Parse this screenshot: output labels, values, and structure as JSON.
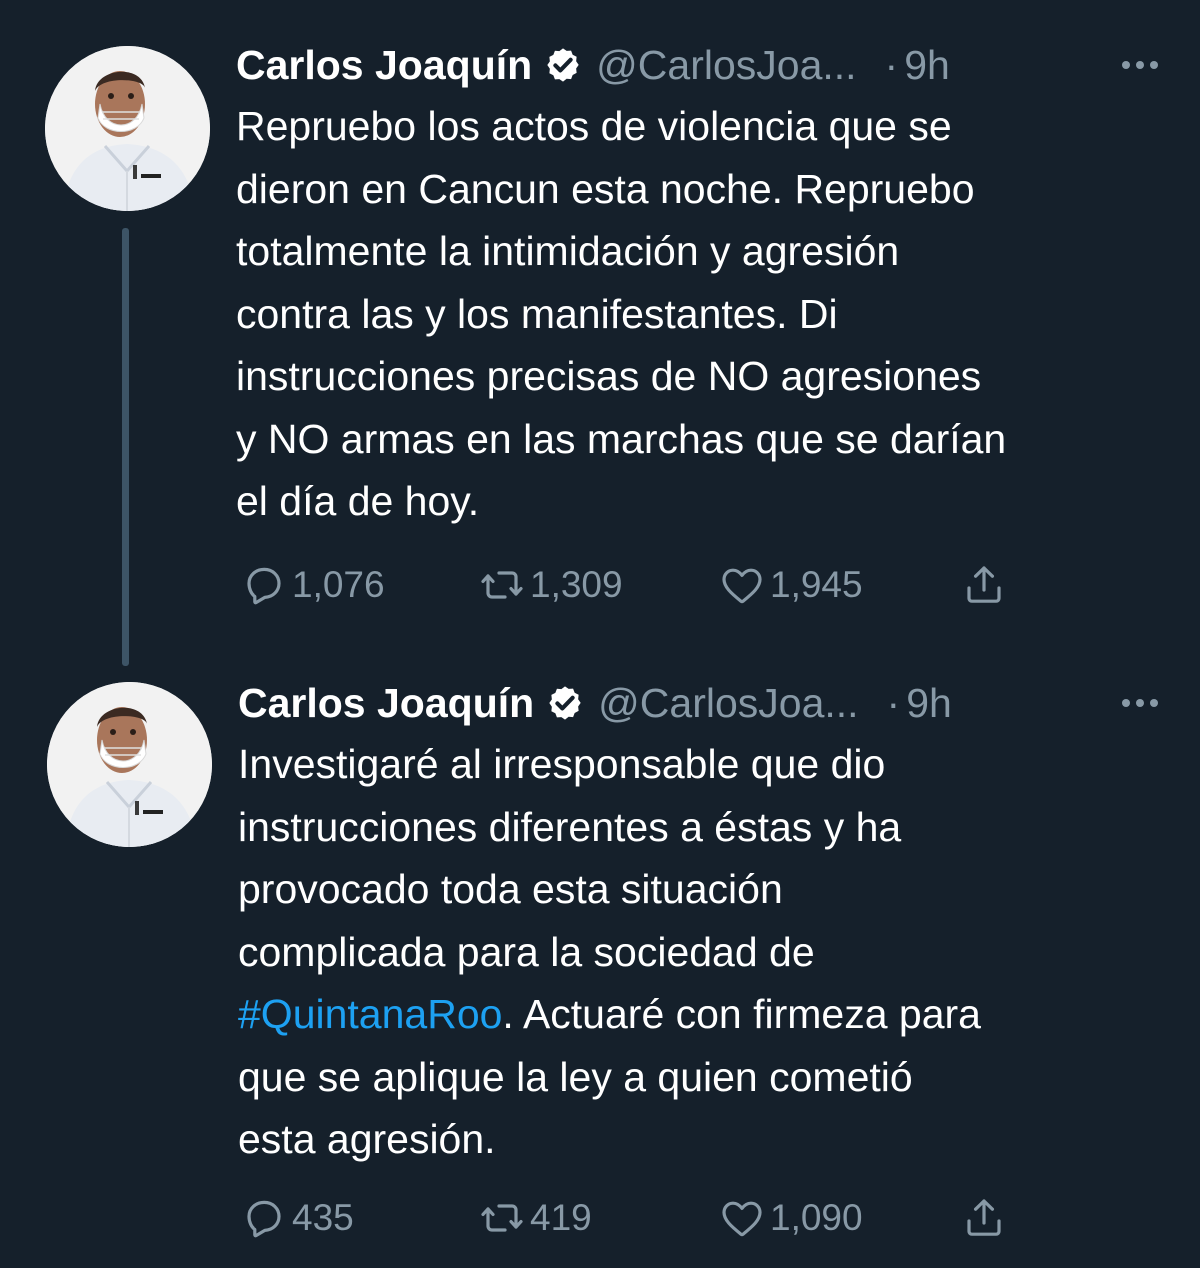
{
  "colors": {
    "background": "#15202b",
    "text": "#ffffff",
    "muted": "#8899a6",
    "link": "#1da1f2",
    "thread_line": "#3d5466"
  },
  "tweets": [
    {
      "author": {
        "name": "Carlos Joaquín",
        "handle": "@CarlosJoa...",
        "verified": true,
        "avatar_icon": "avatar-photo"
      },
      "dot": "·",
      "time": "9h",
      "more_icon": "more-dots-icon",
      "lines": [
        "Repruebo los actos de violencia que se",
        "dieron en Cancun esta noche. Repruebo",
        "totalmente la intimidación y agresión",
        "contra las y los manifestantes. Di",
        "instrucciones precisas de NO agresiones",
        "y NO armas en las marchas que se darían",
        "el día de hoy."
      ],
      "stats": {
        "replies": "1,076",
        "retweets": "1,309",
        "likes": "1,945"
      }
    },
    {
      "author": {
        "name": "Carlos Joaquín",
        "handle": "@CarlosJoa...",
        "verified": true,
        "avatar_icon": "avatar-photo"
      },
      "dot": "·",
      "time": "9h",
      "more_icon": "more-dots-icon",
      "lines": [
        "Investigaré al irresponsable que dio",
        "instrucciones diferentes a éstas y ha",
        "provocado toda esta situación",
        "complicada para la sociedad de"
      ],
      "hashtag": "#QuintanaRoo",
      "line5_rest": ". Actuaré con firmeza para",
      "lines_after": [
        "que se aplique la ley a quien cometió",
        "esta agresión."
      ],
      "stats": {
        "replies": "435",
        "retweets": "419",
        "likes": "1,090"
      }
    }
  ]
}
